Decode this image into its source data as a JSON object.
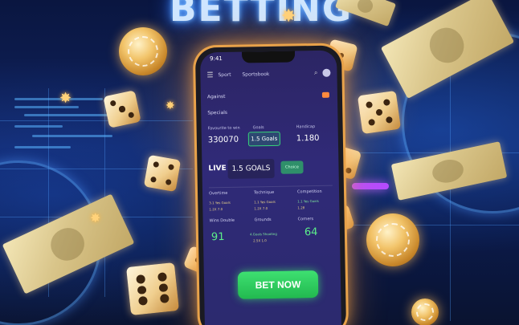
{
  "sign": {
    "text": "BETTING"
  },
  "phone": {
    "status_time": "9:41",
    "topbar": {
      "item_1": "Sport",
      "item_2": "Sportsbook"
    },
    "section_1": "Against",
    "section_2": "Specials",
    "odds": {
      "left_header": "Favourite to win",
      "left_value": "330070",
      "middle_header": "Goals",
      "middle_value": "1.5 Goals",
      "right_header": "Handicap",
      "right_value": "1.180"
    },
    "live": {
      "label": "LIVE",
      "market": "1.5 GOALS",
      "badge": "Choice"
    },
    "stats": {
      "col1_header": "Overtime",
      "col2_header": "Technique",
      "col3_header": "Competition",
      "col1_line1": "3.1 Yes Goals",
      "col1_line2": "1.2X 7.0",
      "col2_line1": "1.1 Yes Goals",
      "col2_line2": "1.2X 7.0",
      "col3_line1": "1.1 Yes Goals",
      "col3_line2": "1.28",
      "row2_col1": "Wins Double",
      "row2_col2": "Grounds",
      "row2_col3": "Corners",
      "big_left": "91",
      "mid_line1": "4.Goals Shooting",
      "mid_line2": "2.5X 1.0",
      "big_right": "64"
    },
    "cta": "BET NOW"
  },
  "colors": {
    "accent_green": "#2fca5f",
    "glow_orange": "#e8a24a",
    "neon_blue": "#3f8cff"
  }
}
